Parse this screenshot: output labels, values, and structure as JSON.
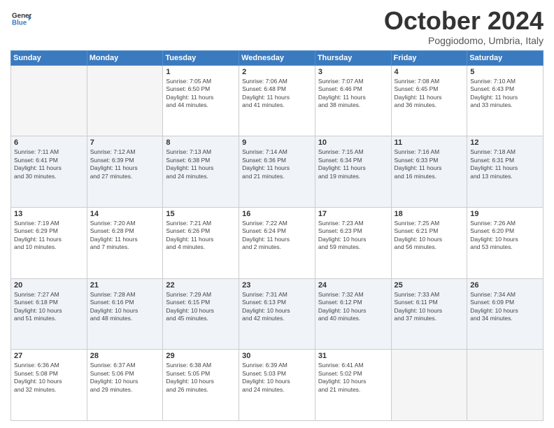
{
  "header": {
    "logo_line1": "General",
    "logo_line2": "Blue",
    "month": "October 2024",
    "location": "Poggiodomo, Umbria, Italy"
  },
  "weekdays": [
    "Sunday",
    "Monday",
    "Tuesday",
    "Wednesday",
    "Thursday",
    "Friday",
    "Saturday"
  ],
  "weeks": [
    [
      {
        "day": "",
        "info": ""
      },
      {
        "day": "",
        "info": ""
      },
      {
        "day": "1",
        "info": "Sunrise: 7:05 AM\nSunset: 6:50 PM\nDaylight: 11 hours\nand 44 minutes."
      },
      {
        "day": "2",
        "info": "Sunrise: 7:06 AM\nSunset: 6:48 PM\nDaylight: 11 hours\nand 41 minutes."
      },
      {
        "day": "3",
        "info": "Sunrise: 7:07 AM\nSunset: 6:46 PM\nDaylight: 11 hours\nand 38 minutes."
      },
      {
        "day": "4",
        "info": "Sunrise: 7:08 AM\nSunset: 6:45 PM\nDaylight: 11 hours\nand 36 minutes."
      },
      {
        "day": "5",
        "info": "Sunrise: 7:10 AM\nSunset: 6:43 PM\nDaylight: 11 hours\nand 33 minutes."
      }
    ],
    [
      {
        "day": "6",
        "info": "Sunrise: 7:11 AM\nSunset: 6:41 PM\nDaylight: 11 hours\nand 30 minutes."
      },
      {
        "day": "7",
        "info": "Sunrise: 7:12 AM\nSunset: 6:39 PM\nDaylight: 11 hours\nand 27 minutes."
      },
      {
        "day": "8",
        "info": "Sunrise: 7:13 AM\nSunset: 6:38 PM\nDaylight: 11 hours\nand 24 minutes."
      },
      {
        "day": "9",
        "info": "Sunrise: 7:14 AM\nSunset: 6:36 PM\nDaylight: 11 hours\nand 21 minutes."
      },
      {
        "day": "10",
        "info": "Sunrise: 7:15 AM\nSunset: 6:34 PM\nDaylight: 11 hours\nand 19 minutes."
      },
      {
        "day": "11",
        "info": "Sunrise: 7:16 AM\nSunset: 6:33 PM\nDaylight: 11 hours\nand 16 minutes."
      },
      {
        "day": "12",
        "info": "Sunrise: 7:18 AM\nSunset: 6:31 PM\nDaylight: 11 hours\nand 13 minutes."
      }
    ],
    [
      {
        "day": "13",
        "info": "Sunrise: 7:19 AM\nSunset: 6:29 PM\nDaylight: 11 hours\nand 10 minutes."
      },
      {
        "day": "14",
        "info": "Sunrise: 7:20 AM\nSunset: 6:28 PM\nDaylight: 11 hours\nand 7 minutes."
      },
      {
        "day": "15",
        "info": "Sunrise: 7:21 AM\nSunset: 6:26 PM\nDaylight: 11 hours\nand 4 minutes."
      },
      {
        "day": "16",
        "info": "Sunrise: 7:22 AM\nSunset: 6:24 PM\nDaylight: 11 hours\nand 2 minutes."
      },
      {
        "day": "17",
        "info": "Sunrise: 7:23 AM\nSunset: 6:23 PM\nDaylight: 10 hours\nand 59 minutes."
      },
      {
        "day": "18",
        "info": "Sunrise: 7:25 AM\nSunset: 6:21 PM\nDaylight: 10 hours\nand 56 minutes."
      },
      {
        "day": "19",
        "info": "Sunrise: 7:26 AM\nSunset: 6:20 PM\nDaylight: 10 hours\nand 53 minutes."
      }
    ],
    [
      {
        "day": "20",
        "info": "Sunrise: 7:27 AM\nSunset: 6:18 PM\nDaylight: 10 hours\nand 51 minutes."
      },
      {
        "day": "21",
        "info": "Sunrise: 7:28 AM\nSunset: 6:16 PM\nDaylight: 10 hours\nand 48 minutes."
      },
      {
        "day": "22",
        "info": "Sunrise: 7:29 AM\nSunset: 6:15 PM\nDaylight: 10 hours\nand 45 minutes."
      },
      {
        "day": "23",
        "info": "Sunrise: 7:31 AM\nSunset: 6:13 PM\nDaylight: 10 hours\nand 42 minutes."
      },
      {
        "day": "24",
        "info": "Sunrise: 7:32 AM\nSunset: 6:12 PM\nDaylight: 10 hours\nand 40 minutes."
      },
      {
        "day": "25",
        "info": "Sunrise: 7:33 AM\nSunset: 6:11 PM\nDaylight: 10 hours\nand 37 minutes."
      },
      {
        "day": "26",
        "info": "Sunrise: 7:34 AM\nSunset: 6:09 PM\nDaylight: 10 hours\nand 34 minutes."
      }
    ],
    [
      {
        "day": "27",
        "info": "Sunrise: 6:36 AM\nSunset: 5:08 PM\nDaylight: 10 hours\nand 32 minutes."
      },
      {
        "day": "28",
        "info": "Sunrise: 6:37 AM\nSunset: 5:06 PM\nDaylight: 10 hours\nand 29 minutes."
      },
      {
        "day": "29",
        "info": "Sunrise: 6:38 AM\nSunset: 5:05 PM\nDaylight: 10 hours\nand 26 minutes."
      },
      {
        "day": "30",
        "info": "Sunrise: 6:39 AM\nSunset: 5:03 PM\nDaylight: 10 hours\nand 24 minutes."
      },
      {
        "day": "31",
        "info": "Sunrise: 6:41 AM\nSunset: 5:02 PM\nDaylight: 10 hours\nand 21 minutes."
      },
      {
        "day": "",
        "info": ""
      },
      {
        "day": "",
        "info": ""
      }
    ]
  ]
}
